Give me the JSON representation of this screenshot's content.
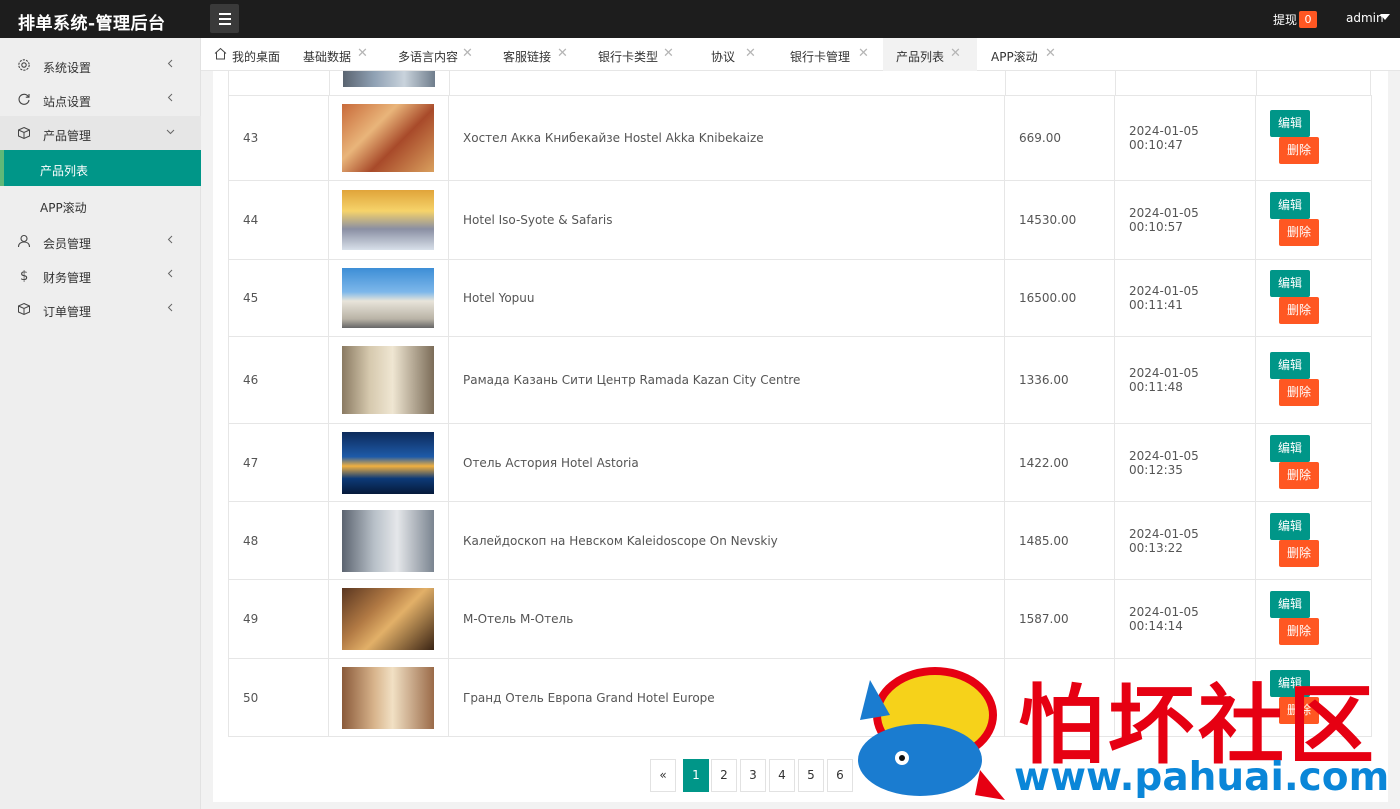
{
  "header": {
    "title": "排单系统-管理后台",
    "withdraw_label": "提现",
    "withdraw_count": "0",
    "user": "admin"
  },
  "sidebar": {
    "items": [
      {
        "label": "系统设置",
        "icon": "gear-icon"
      },
      {
        "label": "站点设置",
        "icon": "refresh-icon"
      },
      {
        "label": "产品管理",
        "icon": "box-icon"
      },
      {
        "label": "产品列表"
      },
      {
        "label": "APP滚动"
      },
      {
        "label": "会员管理",
        "icon": "user-icon"
      },
      {
        "label": "财务管理",
        "icon": "dollar-icon"
      },
      {
        "label": "订单管理",
        "icon": "box-icon"
      }
    ]
  },
  "tabs": [
    {
      "label": "我的桌面"
    },
    {
      "label": "基础数据"
    },
    {
      "label": "多语言内容"
    },
    {
      "label": "客服链接"
    },
    {
      "label": "银行卡类型"
    },
    {
      "label": "协议"
    },
    {
      "label": "银行卡管理"
    },
    {
      "label": "产品列表"
    },
    {
      "label": "APP滚动"
    }
  ],
  "table": {
    "rows": [
      {
        "id": "43",
        "name": "Хостел Акка Книбекайзе Hostel Akka Knibekaize",
        "price": "669.00",
        "time": "2024-01-05 00:10:47"
      },
      {
        "id": "44",
        "name": "Hotel Iso-Syote & Safaris",
        "price": "14530.00",
        "time": "2024-01-05 00:10:57"
      },
      {
        "id": "45",
        "name": "Hotel Yopuu",
        "price": "16500.00",
        "time": "2024-01-05 00:11:41"
      },
      {
        "id": "46",
        "name": "Рамада Казань Сити Центр Ramada Kazan City Centre",
        "price": "1336.00",
        "time": "2024-01-05 00:11:48"
      },
      {
        "id": "47",
        "name": "Отель Астория Hotel Astoria",
        "price": "1422.00",
        "time": "2024-01-05 00:12:35"
      },
      {
        "id": "48",
        "name": "Калейдоскоп на Невском Kaleidoscope On Nevskiy",
        "price": "1485.00",
        "time": "2024-01-05 00:13:22"
      },
      {
        "id": "49",
        "name": "М-Отель М-Отель",
        "price": "1587.00",
        "time": "2024-01-05 00:14:14"
      },
      {
        "id": "50",
        "name": "Гранд Отель Европа Grand Hotel Europe",
        "price": "",
        "time": ""
      }
    ],
    "edit_label": "编辑",
    "delete_label": "删除"
  },
  "pagination": {
    "prev": "«",
    "pages": [
      "1",
      "2",
      "3",
      "4",
      "5",
      "6"
    ],
    "current": "1"
  },
  "watermark": {
    "cn": "怕坏社区",
    "url": "www.pahuai.com"
  },
  "colors": {
    "accent": "#009688",
    "danger": "#ff5722",
    "header_bg": "#1d1d1d"
  }
}
